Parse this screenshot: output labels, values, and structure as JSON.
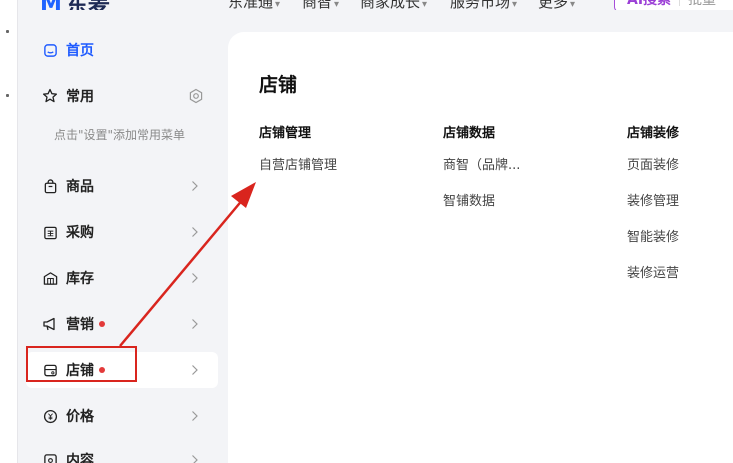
{
  "topnav": {
    "brand_text": "东麦",
    "items": [
      {
        "label": "东准通"
      },
      {
        "label": "商智"
      },
      {
        "label": "商家成长"
      },
      {
        "label": "服务市场"
      },
      {
        "label": "更多"
      }
    ],
    "ai_search_label": "AI搜索",
    "search_hint": "批量"
  },
  "sidebar": {
    "home_label": "首页",
    "common_label": "常用",
    "common_hint": "点击\"设置\"添加常用菜单",
    "items": [
      {
        "label": "商品",
        "has_dot": false
      },
      {
        "label": "采购",
        "has_dot": false
      },
      {
        "label": "库存",
        "has_dot": false
      },
      {
        "label": "营销",
        "has_dot": true
      },
      {
        "label": "店铺",
        "has_dot": true
      },
      {
        "label": "价格",
        "has_dot": false
      },
      {
        "label": "内容",
        "has_dot": false
      }
    ]
  },
  "panel": {
    "title": "店铺",
    "columns": [
      {
        "heading": "店铺管理",
        "links": [
          "自营店铺管理"
        ]
      },
      {
        "heading": "店铺数据",
        "links": [
          "商智（品牌...",
          "智铺数据"
        ]
      },
      {
        "heading": "店铺装修",
        "links": [
          "页面装修",
          "装修管理",
          "智能装修",
          "装修运营"
        ]
      }
    ]
  },
  "colors": {
    "accent_blue": "#1f5bff",
    "dot_red": "#e33a3a",
    "annotation_red": "#d9251e",
    "ai_purple": "#9b3fd6"
  }
}
